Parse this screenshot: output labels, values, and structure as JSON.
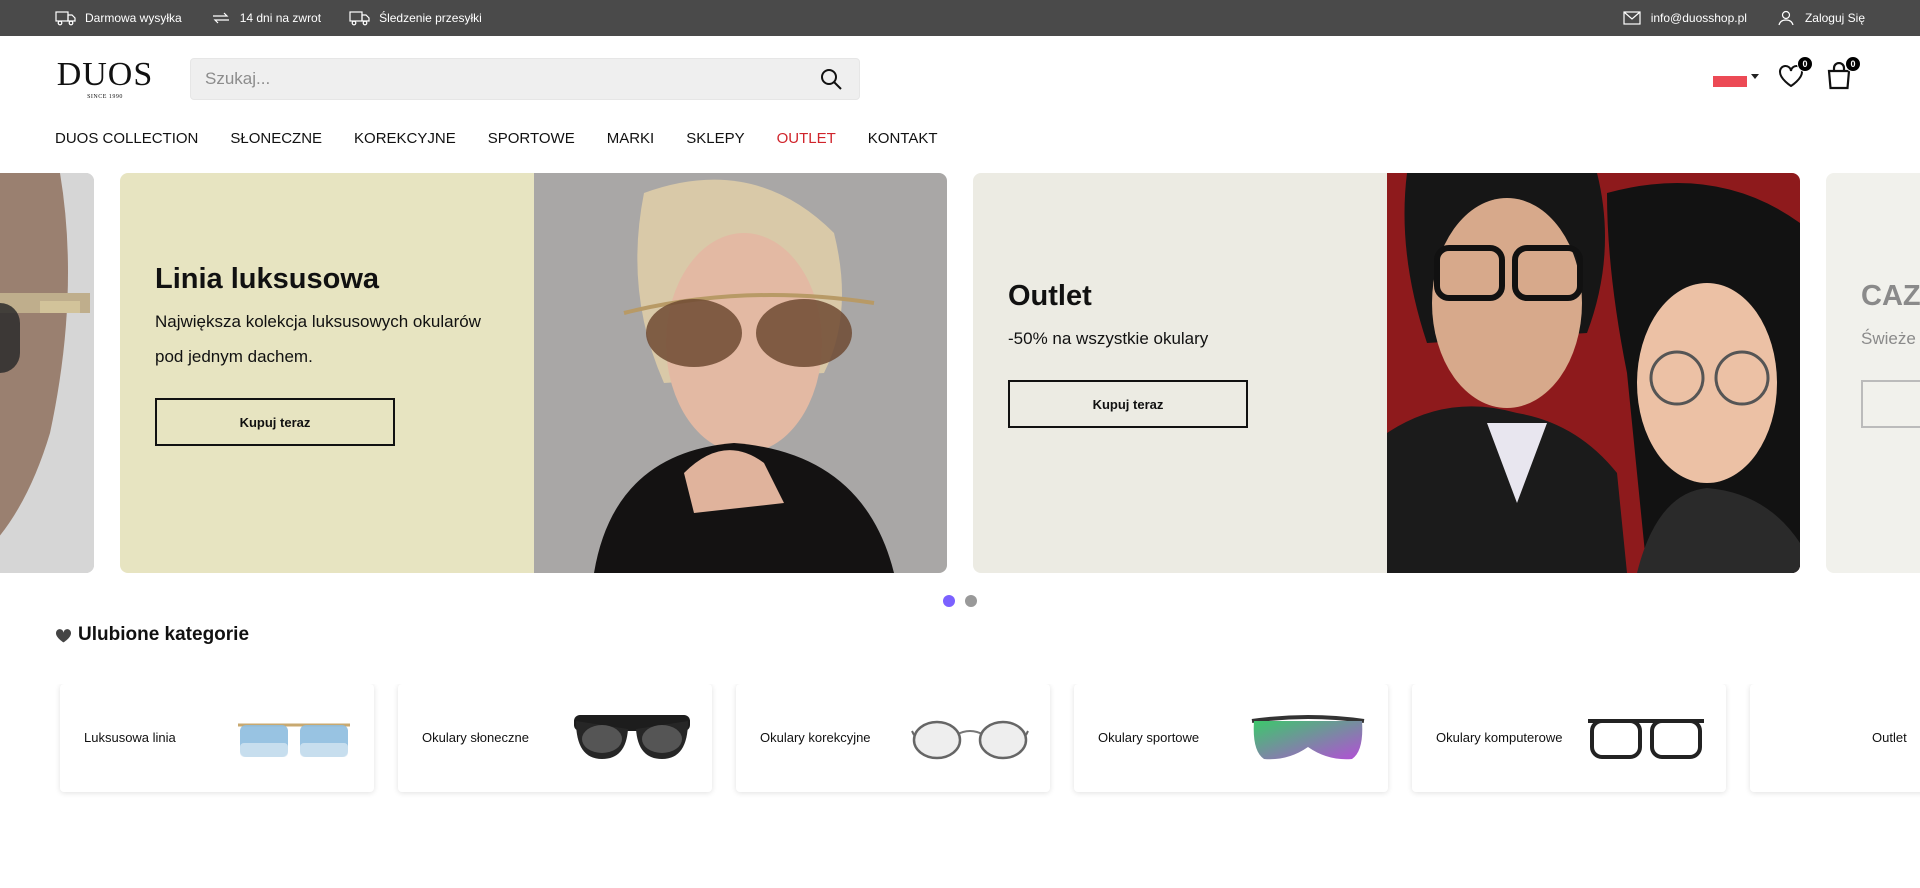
{
  "topbar": {
    "shipping": "Darmowa wysyłka",
    "returns": "14 dni na zwrot",
    "tracking": "Śledzenie przesyłki",
    "email": "info@duosshop.pl",
    "login": "Zaloguj Się"
  },
  "header": {
    "logo": "DUOS",
    "logo_sub": "SINCE 1990",
    "search_placeholder": "Szukaj...",
    "wishlist_count": "0",
    "cart_count": "0"
  },
  "nav": {
    "items": [
      "DUOS COLLECTION",
      "SŁONECZNE",
      "KOREKCYJNE",
      "SPORTOWE",
      "MARKI",
      "SKLEPY",
      "OUTLET",
      "KONTAKT"
    ]
  },
  "slides": [
    {
      "title": "Linia luksusowa",
      "text": "Największa kolekcja luksusowych okularów pod jednym dachem.",
      "button": "Kupuj teraz",
      "bg": "#e7e4c1"
    },
    {
      "title": "Outlet",
      "text": "-50% na wszystkie okulary",
      "button": "Kupuj teraz",
      "bg": "#ecebe3"
    },
    {
      "title": "CAZA",
      "text": "Świeże z",
      "bg": "#f1f1ec"
    }
  ],
  "carousel": {
    "active_dot": 0,
    "dot_count": 2,
    "accent": "#7b61ff"
  },
  "categories": {
    "title": "Ulubione kategorie",
    "items": [
      "Luksusowa linia",
      "Okulary słoneczne",
      "Okulary korekcyjne",
      "Okulary sportowe",
      "Okulary komputerowe",
      "Outlet"
    ]
  },
  "colors": {
    "topbar": "#4a4a4a",
    "outlet": "#d0242b"
  }
}
